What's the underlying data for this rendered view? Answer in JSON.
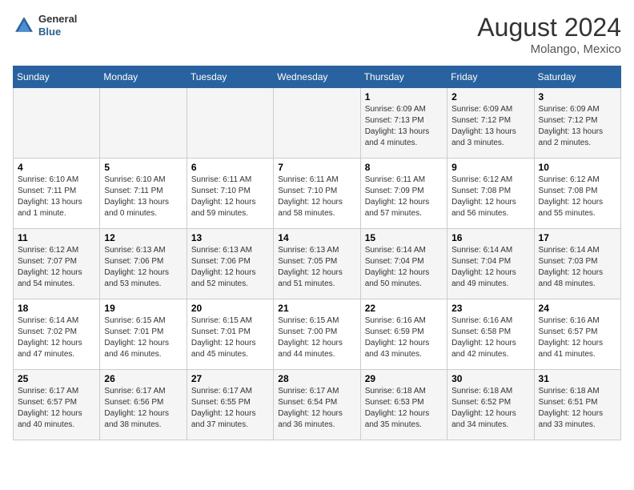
{
  "header": {
    "logo_general": "General",
    "logo_blue": "Blue",
    "month_year": "August 2024",
    "location": "Molango, Mexico"
  },
  "days_of_week": [
    "Sunday",
    "Monday",
    "Tuesday",
    "Wednesday",
    "Thursday",
    "Friday",
    "Saturday"
  ],
  "weeks": [
    [
      {
        "day": "",
        "info": ""
      },
      {
        "day": "",
        "info": ""
      },
      {
        "day": "",
        "info": ""
      },
      {
        "day": "",
        "info": ""
      },
      {
        "day": "1",
        "info": "Sunrise: 6:09 AM\nSunset: 7:13 PM\nDaylight: 13 hours\nand 4 minutes."
      },
      {
        "day": "2",
        "info": "Sunrise: 6:09 AM\nSunset: 7:12 PM\nDaylight: 13 hours\nand 3 minutes."
      },
      {
        "day": "3",
        "info": "Sunrise: 6:09 AM\nSunset: 7:12 PM\nDaylight: 13 hours\nand 2 minutes."
      }
    ],
    [
      {
        "day": "4",
        "info": "Sunrise: 6:10 AM\nSunset: 7:11 PM\nDaylight: 13 hours\nand 1 minute."
      },
      {
        "day": "5",
        "info": "Sunrise: 6:10 AM\nSunset: 7:11 PM\nDaylight: 13 hours\nand 0 minutes."
      },
      {
        "day": "6",
        "info": "Sunrise: 6:11 AM\nSunset: 7:10 PM\nDaylight: 12 hours\nand 59 minutes."
      },
      {
        "day": "7",
        "info": "Sunrise: 6:11 AM\nSunset: 7:10 PM\nDaylight: 12 hours\nand 58 minutes."
      },
      {
        "day": "8",
        "info": "Sunrise: 6:11 AM\nSunset: 7:09 PM\nDaylight: 12 hours\nand 57 minutes."
      },
      {
        "day": "9",
        "info": "Sunrise: 6:12 AM\nSunset: 7:08 PM\nDaylight: 12 hours\nand 56 minutes."
      },
      {
        "day": "10",
        "info": "Sunrise: 6:12 AM\nSunset: 7:08 PM\nDaylight: 12 hours\nand 55 minutes."
      }
    ],
    [
      {
        "day": "11",
        "info": "Sunrise: 6:12 AM\nSunset: 7:07 PM\nDaylight: 12 hours\nand 54 minutes."
      },
      {
        "day": "12",
        "info": "Sunrise: 6:13 AM\nSunset: 7:06 PM\nDaylight: 12 hours\nand 53 minutes."
      },
      {
        "day": "13",
        "info": "Sunrise: 6:13 AM\nSunset: 7:06 PM\nDaylight: 12 hours\nand 52 minutes."
      },
      {
        "day": "14",
        "info": "Sunrise: 6:13 AM\nSunset: 7:05 PM\nDaylight: 12 hours\nand 51 minutes."
      },
      {
        "day": "15",
        "info": "Sunrise: 6:14 AM\nSunset: 7:04 PM\nDaylight: 12 hours\nand 50 minutes."
      },
      {
        "day": "16",
        "info": "Sunrise: 6:14 AM\nSunset: 7:04 PM\nDaylight: 12 hours\nand 49 minutes."
      },
      {
        "day": "17",
        "info": "Sunrise: 6:14 AM\nSunset: 7:03 PM\nDaylight: 12 hours\nand 48 minutes."
      }
    ],
    [
      {
        "day": "18",
        "info": "Sunrise: 6:14 AM\nSunset: 7:02 PM\nDaylight: 12 hours\nand 47 minutes."
      },
      {
        "day": "19",
        "info": "Sunrise: 6:15 AM\nSunset: 7:01 PM\nDaylight: 12 hours\nand 46 minutes."
      },
      {
        "day": "20",
        "info": "Sunrise: 6:15 AM\nSunset: 7:01 PM\nDaylight: 12 hours\nand 45 minutes."
      },
      {
        "day": "21",
        "info": "Sunrise: 6:15 AM\nSunset: 7:00 PM\nDaylight: 12 hours\nand 44 minutes."
      },
      {
        "day": "22",
        "info": "Sunrise: 6:16 AM\nSunset: 6:59 PM\nDaylight: 12 hours\nand 43 minutes."
      },
      {
        "day": "23",
        "info": "Sunrise: 6:16 AM\nSunset: 6:58 PM\nDaylight: 12 hours\nand 42 minutes."
      },
      {
        "day": "24",
        "info": "Sunrise: 6:16 AM\nSunset: 6:57 PM\nDaylight: 12 hours\nand 41 minutes."
      }
    ],
    [
      {
        "day": "25",
        "info": "Sunrise: 6:17 AM\nSunset: 6:57 PM\nDaylight: 12 hours\nand 40 minutes."
      },
      {
        "day": "26",
        "info": "Sunrise: 6:17 AM\nSunset: 6:56 PM\nDaylight: 12 hours\nand 38 minutes."
      },
      {
        "day": "27",
        "info": "Sunrise: 6:17 AM\nSunset: 6:55 PM\nDaylight: 12 hours\nand 37 minutes."
      },
      {
        "day": "28",
        "info": "Sunrise: 6:17 AM\nSunset: 6:54 PM\nDaylight: 12 hours\nand 36 minutes."
      },
      {
        "day": "29",
        "info": "Sunrise: 6:18 AM\nSunset: 6:53 PM\nDaylight: 12 hours\nand 35 minutes."
      },
      {
        "day": "30",
        "info": "Sunrise: 6:18 AM\nSunset: 6:52 PM\nDaylight: 12 hours\nand 34 minutes."
      },
      {
        "day": "31",
        "info": "Sunrise: 6:18 AM\nSunset: 6:51 PM\nDaylight: 12 hours\nand 33 minutes."
      }
    ]
  ]
}
